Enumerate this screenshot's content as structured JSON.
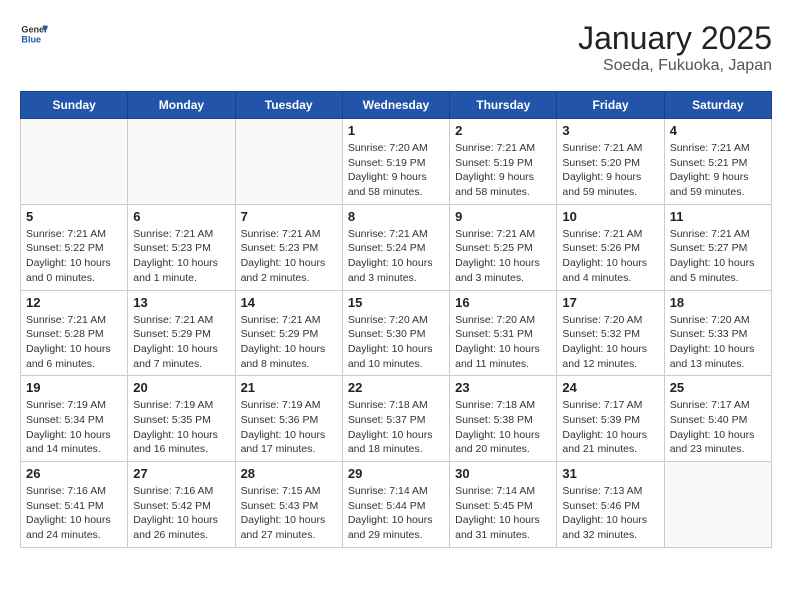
{
  "header": {
    "logo_general": "General",
    "logo_blue": "Blue",
    "title": "January 2025",
    "subtitle": "Soeda, Fukuoka, Japan"
  },
  "days_of_week": [
    "Sunday",
    "Monday",
    "Tuesday",
    "Wednesday",
    "Thursday",
    "Friday",
    "Saturday"
  ],
  "weeks": [
    [
      {
        "day": "",
        "info": ""
      },
      {
        "day": "",
        "info": ""
      },
      {
        "day": "",
        "info": ""
      },
      {
        "day": "1",
        "info": "Sunrise: 7:20 AM\nSunset: 5:19 PM\nDaylight: 9 hours and 58 minutes."
      },
      {
        "day": "2",
        "info": "Sunrise: 7:21 AM\nSunset: 5:19 PM\nDaylight: 9 hours and 58 minutes."
      },
      {
        "day": "3",
        "info": "Sunrise: 7:21 AM\nSunset: 5:20 PM\nDaylight: 9 hours and 59 minutes."
      },
      {
        "day": "4",
        "info": "Sunrise: 7:21 AM\nSunset: 5:21 PM\nDaylight: 9 hours and 59 minutes."
      }
    ],
    [
      {
        "day": "5",
        "info": "Sunrise: 7:21 AM\nSunset: 5:22 PM\nDaylight: 10 hours and 0 minutes."
      },
      {
        "day": "6",
        "info": "Sunrise: 7:21 AM\nSunset: 5:23 PM\nDaylight: 10 hours and 1 minute."
      },
      {
        "day": "7",
        "info": "Sunrise: 7:21 AM\nSunset: 5:23 PM\nDaylight: 10 hours and 2 minutes."
      },
      {
        "day": "8",
        "info": "Sunrise: 7:21 AM\nSunset: 5:24 PM\nDaylight: 10 hours and 3 minutes."
      },
      {
        "day": "9",
        "info": "Sunrise: 7:21 AM\nSunset: 5:25 PM\nDaylight: 10 hours and 3 minutes."
      },
      {
        "day": "10",
        "info": "Sunrise: 7:21 AM\nSunset: 5:26 PM\nDaylight: 10 hours and 4 minutes."
      },
      {
        "day": "11",
        "info": "Sunrise: 7:21 AM\nSunset: 5:27 PM\nDaylight: 10 hours and 5 minutes."
      }
    ],
    [
      {
        "day": "12",
        "info": "Sunrise: 7:21 AM\nSunset: 5:28 PM\nDaylight: 10 hours and 6 minutes."
      },
      {
        "day": "13",
        "info": "Sunrise: 7:21 AM\nSunset: 5:29 PM\nDaylight: 10 hours and 7 minutes."
      },
      {
        "day": "14",
        "info": "Sunrise: 7:21 AM\nSunset: 5:29 PM\nDaylight: 10 hours and 8 minutes."
      },
      {
        "day": "15",
        "info": "Sunrise: 7:20 AM\nSunset: 5:30 PM\nDaylight: 10 hours and 10 minutes."
      },
      {
        "day": "16",
        "info": "Sunrise: 7:20 AM\nSunset: 5:31 PM\nDaylight: 10 hours and 11 minutes."
      },
      {
        "day": "17",
        "info": "Sunrise: 7:20 AM\nSunset: 5:32 PM\nDaylight: 10 hours and 12 minutes."
      },
      {
        "day": "18",
        "info": "Sunrise: 7:20 AM\nSunset: 5:33 PM\nDaylight: 10 hours and 13 minutes."
      }
    ],
    [
      {
        "day": "19",
        "info": "Sunrise: 7:19 AM\nSunset: 5:34 PM\nDaylight: 10 hours and 14 minutes."
      },
      {
        "day": "20",
        "info": "Sunrise: 7:19 AM\nSunset: 5:35 PM\nDaylight: 10 hours and 16 minutes."
      },
      {
        "day": "21",
        "info": "Sunrise: 7:19 AM\nSunset: 5:36 PM\nDaylight: 10 hours and 17 minutes."
      },
      {
        "day": "22",
        "info": "Sunrise: 7:18 AM\nSunset: 5:37 PM\nDaylight: 10 hours and 18 minutes."
      },
      {
        "day": "23",
        "info": "Sunrise: 7:18 AM\nSunset: 5:38 PM\nDaylight: 10 hours and 20 minutes."
      },
      {
        "day": "24",
        "info": "Sunrise: 7:17 AM\nSunset: 5:39 PM\nDaylight: 10 hours and 21 minutes."
      },
      {
        "day": "25",
        "info": "Sunrise: 7:17 AM\nSunset: 5:40 PM\nDaylight: 10 hours and 23 minutes."
      }
    ],
    [
      {
        "day": "26",
        "info": "Sunrise: 7:16 AM\nSunset: 5:41 PM\nDaylight: 10 hours and 24 minutes."
      },
      {
        "day": "27",
        "info": "Sunrise: 7:16 AM\nSunset: 5:42 PM\nDaylight: 10 hours and 26 minutes."
      },
      {
        "day": "28",
        "info": "Sunrise: 7:15 AM\nSunset: 5:43 PM\nDaylight: 10 hours and 27 minutes."
      },
      {
        "day": "29",
        "info": "Sunrise: 7:14 AM\nSunset: 5:44 PM\nDaylight: 10 hours and 29 minutes."
      },
      {
        "day": "30",
        "info": "Sunrise: 7:14 AM\nSunset: 5:45 PM\nDaylight: 10 hours and 31 minutes."
      },
      {
        "day": "31",
        "info": "Sunrise: 7:13 AM\nSunset: 5:46 PM\nDaylight: 10 hours and 32 minutes."
      },
      {
        "day": "",
        "info": ""
      }
    ]
  ]
}
